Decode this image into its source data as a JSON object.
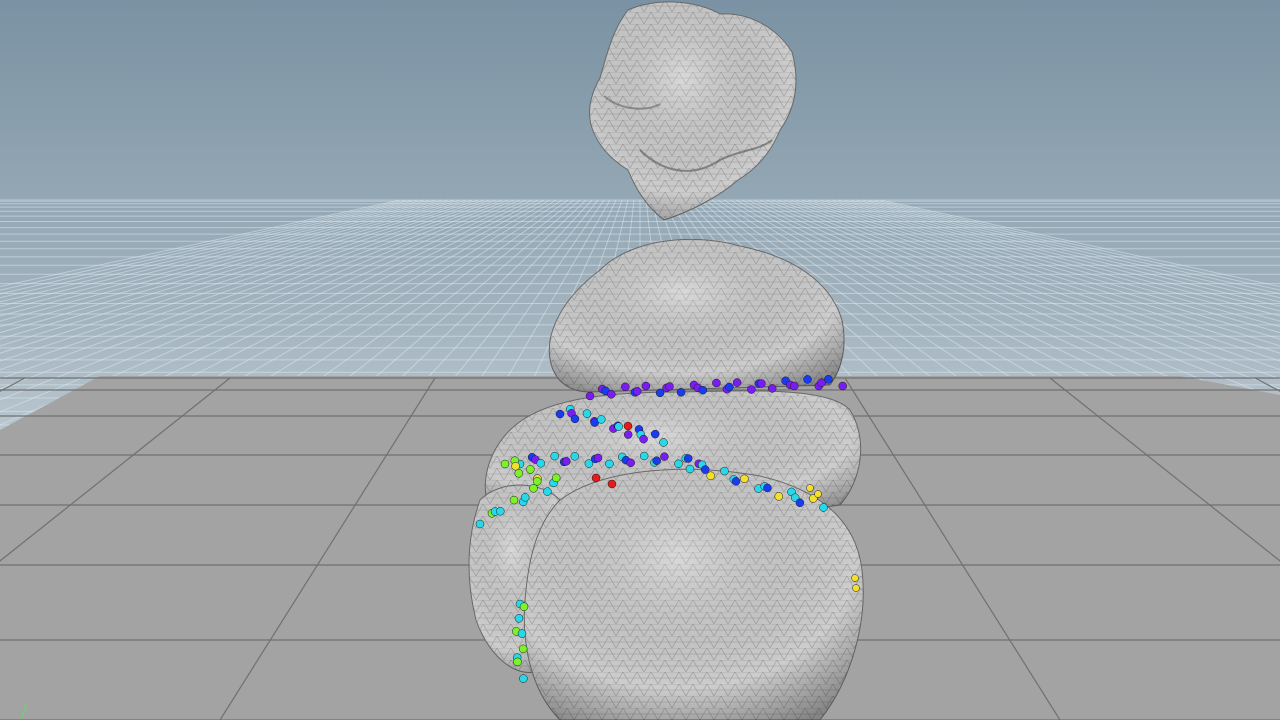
{
  "viewport": {
    "kind": "3d-perspective-viewport",
    "background_top": "#7d95a6",
    "background_bottom": "#b9c6cf",
    "far_grid_color": "#d9e6ef",
    "floor_color": "#a2a2a2",
    "floor_line_color": "#6e6e6e"
  },
  "objects": [
    {
      "name": "floating-rock-chunk",
      "surface_color": "#c8c8c8",
      "wire_color": "#8a8a8a"
    },
    {
      "name": "fractured-rock-stack",
      "surface_color": "#c8c8c8",
      "wire_color": "#8a8a8a"
    }
  ],
  "constraint_points": {
    "colors": [
      "#7a1cf2",
      "#1a3cf0",
      "#28d8e8",
      "#7cf22a",
      "#f2e02a",
      "#f25a1a",
      "#e81a1a"
    ]
  },
  "axis_indicator": {
    "color": "#6fd06f"
  }
}
